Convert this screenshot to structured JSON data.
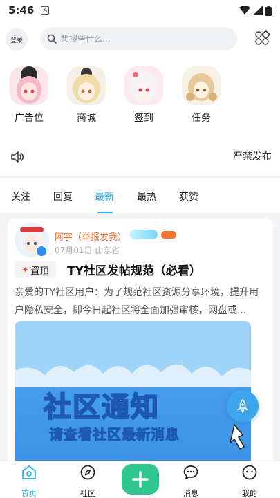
{
  "status_bar": {
    "time": "5:46",
    "notification_letter": "A"
  },
  "top_bar": {
    "login_label": "登录",
    "search_placeholder": "想搜些什么..."
  },
  "shortcuts": [
    {
      "label": "广告位",
      "icon": "anime-girl-pink-icon"
    },
    {
      "label": "商城",
      "icon": "anime-girl-blonde-icon"
    },
    {
      "label": "签到",
      "icon": "anime-girl-white-icon"
    },
    {
      "label": "任务",
      "icon": "anime-girl-animals-icon"
    }
  ],
  "notice": {
    "text": "严禁发布"
  },
  "tabs": [
    {
      "label": "关注",
      "active": false
    },
    {
      "label": "回复",
      "active": false
    },
    {
      "label": "最新",
      "active": true
    },
    {
      "label": "最热",
      "active": false
    },
    {
      "label": "获赞",
      "active": false
    }
  ],
  "post": {
    "author": "阿宇（举报发我）",
    "date": "07月01日",
    "location": "山东省",
    "meta": "07月01日   山东省",
    "pin_label": "置顶",
    "title": "TY社区发帖规范（必看）",
    "body": "亲爱的TY社区用户：为了规范社区资源分享环境，提升用户隐私安全，即今日起社区将全面加强审核，网盘或...",
    "image_title": "社区通知",
    "image_subtitle": "请查看社区最新消息"
  },
  "bottom_nav": [
    {
      "label": "首页",
      "active": true
    },
    {
      "label": "社区",
      "active": false
    },
    {
      "label": "消息",
      "active": false
    },
    {
      "label": "我的",
      "active": false
    }
  ],
  "colors": {
    "accent": "#2bb0f0",
    "post_button": "#2ec58e",
    "author": "#f26b32",
    "rocket": "#3ea6ec"
  }
}
